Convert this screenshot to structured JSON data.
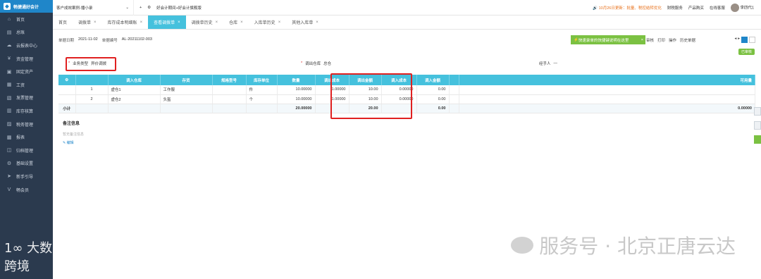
{
  "app": {
    "name": "畅捷通好会计"
  },
  "sidebar": {
    "items": [
      {
        "icon": "home-icon",
        "label": "首页"
      },
      {
        "icon": "ledger-icon",
        "label": "总账"
      },
      {
        "icon": "cloud-report-icon",
        "label": "云报表中心"
      },
      {
        "icon": "cash-icon",
        "label": "资金管理"
      },
      {
        "icon": "asset-icon",
        "label": "固定资产"
      },
      {
        "icon": "payroll-icon",
        "label": "工资"
      },
      {
        "icon": "invoice-icon",
        "label": "发票管理"
      },
      {
        "icon": "inventory-icon",
        "label": "库存核算"
      },
      {
        "icon": "tax-icon",
        "label": "税务管理"
      },
      {
        "icon": "report-icon",
        "label": "报表"
      },
      {
        "icon": "archive-icon",
        "label": "归档管理"
      },
      {
        "icon": "settings-icon",
        "label": "基础设置"
      },
      {
        "icon": "guide-icon",
        "label": "新手引导"
      },
      {
        "icon": "vip-icon",
        "label": "畅会员"
      }
    ],
    "watermark": "1∞ 大数跨境"
  },
  "topbar": {
    "company": "客户成效案例-播小录",
    "add": "+",
    "book_status": "好会计期间+好会计旗舰版",
    "notice": "10月26日更新：批量、税控结转优化",
    "links": [
      "财税服务",
      "产品购买",
      "在线客服"
    ],
    "user": "李四代1"
  },
  "tabs": [
    {
      "label": "首页",
      "closable": false,
      "active": false
    },
    {
      "label": "调拨单",
      "closable": true,
      "active": false
    },
    {
      "label": "库存成本明细账",
      "closable": true,
      "active": false
    },
    {
      "label": "查看调拨单",
      "closable": true,
      "active": true
    },
    {
      "label": "调拨单历史",
      "closable": true,
      "active": false
    },
    {
      "label": "仓库",
      "closable": true,
      "active": false
    },
    {
      "label": "入库单历史",
      "closable": true,
      "active": false
    },
    {
      "label": "其他入库单",
      "closable": true,
      "active": false
    }
  ],
  "doc": {
    "date_label": "单据日期",
    "date": "2021-11-02",
    "no_label": "单据编号",
    "no": "AL-20211102-003",
    "toast": "快速录单的快捷键说明在这里",
    "toolbar": [
      "审核",
      "打印",
      "操作",
      "历史单据"
    ],
    "status": "已审核",
    "biz_type_label": "业务类型",
    "biz_type": "异价调拨",
    "out_wh_label": "调出仓库",
    "out_wh": "总仓",
    "handler_label": "经手人",
    "handler": "—"
  },
  "table": {
    "columns": [
      "调入仓库",
      "存货",
      "规格型号",
      "库存单位",
      "数量",
      "调出成本",
      "调出金额",
      "调入成本",
      "调入金额",
      "",
      "可用量"
    ],
    "rows": [
      {
        "idx": "1",
        "wh": "虚仓1",
        "item": "工作服",
        "spec": "",
        "unit": "件",
        "qty": "10.00000",
        "out_cost": "1.00000",
        "out_amt": "10.00",
        "in_cost": "0.00000",
        "in_amt": "0.00"
      },
      {
        "idx": "2",
        "wh": "虚仓2",
        "item": "头盔",
        "spec": "",
        "unit": "个",
        "qty": "10.00000",
        "out_cost": "1.00000",
        "out_amt": "10.00",
        "in_cost": "0.00000",
        "in_amt": "0.00"
      }
    ],
    "summary": {
      "label": "小计",
      "qty": "20.00000",
      "out_amt": "20.00",
      "in_amt": "0.00",
      "avail": "0.00000"
    }
  },
  "notes": {
    "title": "备注信息",
    "empty": "暂无备注信息",
    "edit": "编辑"
  },
  "watermark": "服务号 · 北京正唐云达",
  "colors": {
    "accent": "#45c1dd",
    "sidebar": "#2b3a4e",
    "brand": "#1f86c9",
    "highlight": "#e02020",
    "green": "#7bc142"
  }
}
